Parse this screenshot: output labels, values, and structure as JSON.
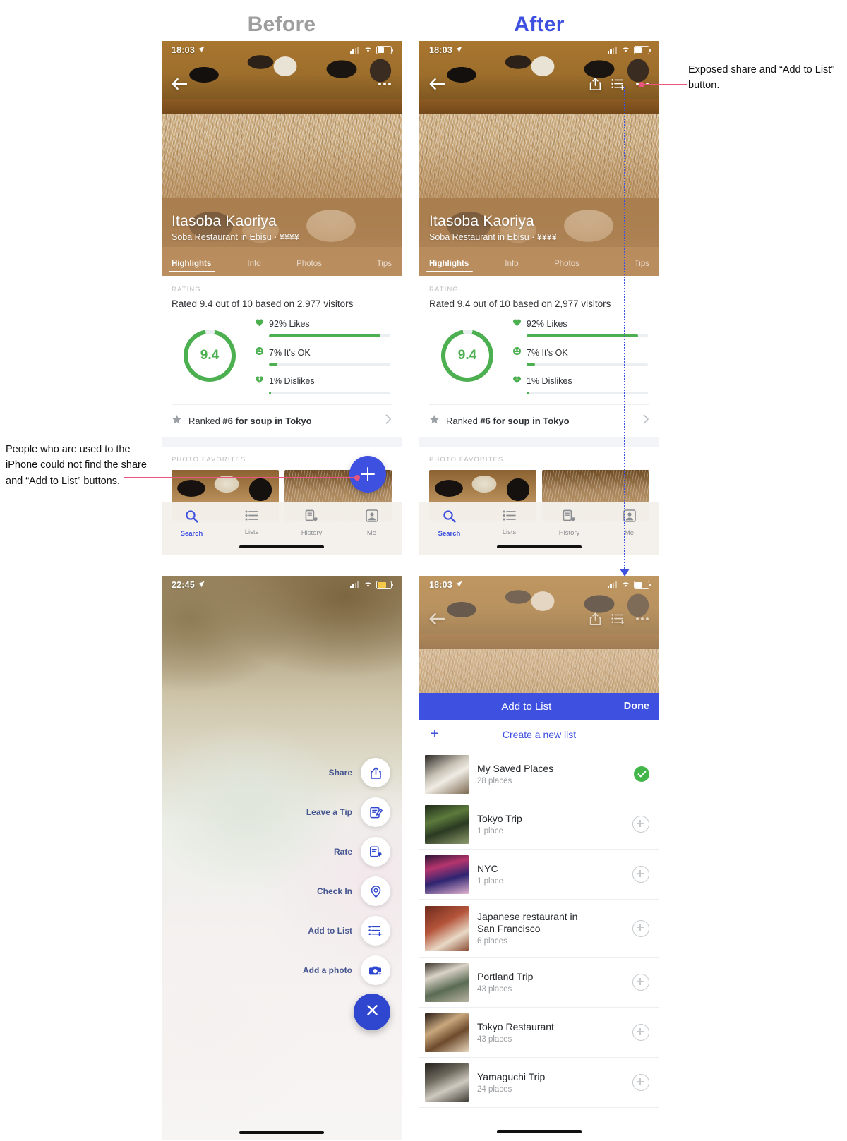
{
  "headings": {
    "before": "Before",
    "after": "After"
  },
  "annotations": {
    "left": "People who are used to the iPhone could not find the share and “Add to List” buttons.",
    "right": "Exposed share and “Add to List” button."
  },
  "statusbar": {
    "time_detail": "18:03",
    "time_actions": "22:45",
    "location_icon": "location-arrow-icon",
    "signal_icon": "cellular-signal-icon",
    "wifi_icon": "wifi-icon",
    "battery_icon": "battery-icon"
  },
  "venue": {
    "name": "Itasoba Kaoriya",
    "meta": "Soba Restaurant in Ebisu · ¥¥¥¥",
    "tabs": [
      {
        "label": "Highlights",
        "active": true
      },
      {
        "label": "Info",
        "active": false
      },
      {
        "label": "Photos",
        "active": false
      },
      {
        "label": "Tips",
        "active": false
      }
    ],
    "nav": {
      "back_icon": "back-arrow-icon",
      "more_icon": "more-ellipsis-icon",
      "share_icon": "share-icon",
      "add_to_list_icon": "add-to-list-icon"
    }
  },
  "rating": {
    "kicker": "RATING",
    "summary": "Rated 9.4 out of 10 based on 2,977 visitors",
    "score": "9.4",
    "breakdown": [
      {
        "label": "92% Likes",
        "percent": 92,
        "icon": "heart-icon"
      },
      {
        "label": "7% It's OK",
        "percent": 7,
        "icon": "neutral-face-icon"
      },
      {
        "label": "1% Dislikes",
        "percent": 1,
        "icon": "broken-heart-icon"
      }
    ]
  },
  "ranked": {
    "prefix": "Ranked ",
    "bold": "#6 for soup in Tokyo",
    "star_icon": "star-icon",
    "chevron_icon": "chevron-right-icon"
  },
  "photo_favorites": {
    "kicker": "PHOTO FAVORITES"
  },
  "tabbar": [
    {
      "label": "Search",
      "icon": "search-icon",
      "active": true
    },
    {
      "label": "Lists",
      "icon": "lists-icon",
      "active": false
    },
    {
      "label": "History",
      "icon": "history-icon",
      "active": false
    },
    {
      "label": "Me",
      "icon": "profile-icon",
      "active": false
    }
  ],
  "fab": {
    "icon": "plus-icon"
  },
  "action_sheet": {
    "items": [
      {
        "label": "Share",
        "icon": "share-icon"
      },
      {
        "label": "Leave a Tip",
        "icon": "edit-note-icon"
      },
      {
        "label": "Rate",
        "icon": "rate-heart-icon"
      },
      {
        "label": "Check In",
        "icon": "check-in-pin-icon"
      },
      {
        "label": "Add to List",
        "icon": "add-to-list-icon"
      },
      {
        "label": "Add a photo",
        "icon": "camera-plus-icon"
      }
    ],
    "close_icon": "close-x-icon"
  },
  "add_to_list": {
    "title": "Add to List",
    "done_label": "Done",
    "create_label": "Create a new list",
    "create_icon": "plus-icon",
    "lists": [
      {
        "name": "My Saved Places",
        "places": "28 places",
        "state": "added",
        "thumb": "p1"
      },
      {
        "name": "Tokyo Trip",
        "places": "1 place",
        "state": "add",
        "thumb": "p2"
      },
      {
        "name": "NYC",
        "places": "1 place",
        "state": "add",
        "thumb": "p3"
      },
      {
        "name": "Japanese restaurant in San Francisco",
        "places": "6 places",
        "state": "add",
        "thumb": "p4"
      },
      {
        "name": "Portland Trip",
        "places": "43 places",
        "state": "add",
        "thumb": "p5"
      },
      {
        "name": "Tokyo Restaurant",
        "places": "43 places",
        "state": "add",
        "thumb": "p6"
      },
      {
        "name": "Yamaguchi Trip",
        "places": "24 places",
        "state": "add",
        "thumb": "p7"
      }
    ]
  },
  "colors": {
    "accent_blue": "#3d50e0",
    "rating_green": "#4caf50",
    "annotation_pink": "#e8557f",
    "before_grey": "#9e9e9e",
    "check_green": "#43b649"
  }
}
